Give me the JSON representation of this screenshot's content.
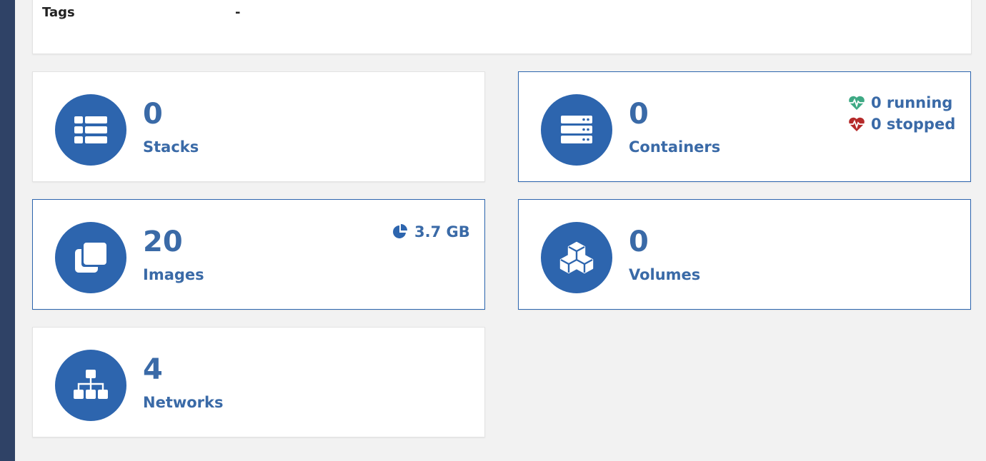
{
  "info": {
    "tags_label": "Tags",
    "tags_value": "-"
  },
  "stacks": {
    "count": "0",
    "label": "Stacks",
    "icon": "list-icon"
  },
  "containers": {
    "count": "0",
    "label": "Containers",
    "icon": "server-icon",
    "running": "0 running",
    "stopped": "0 stopped",
    "running_color": "#3ea984",
    "stopped_color": "#b52a2a"
  },
  "images": {
    "count": "20",
    "label": "Images",
    "icon": "clone-icon",
    "size": "3.7 GB"
  },
  "volumes": {
    "count": "0",
    "label": "Volumes",
    "icon": "cubes-icon"
  },
  "networks": {
    "count": "4",
    "label": "Networks",
    "icon": "sitemap-icon"
  },
  "colors": {
    "accent": "#2d65ae",
    "text": "#3a6aa7",
    "sidebar": "#2f4266"
  }
}
